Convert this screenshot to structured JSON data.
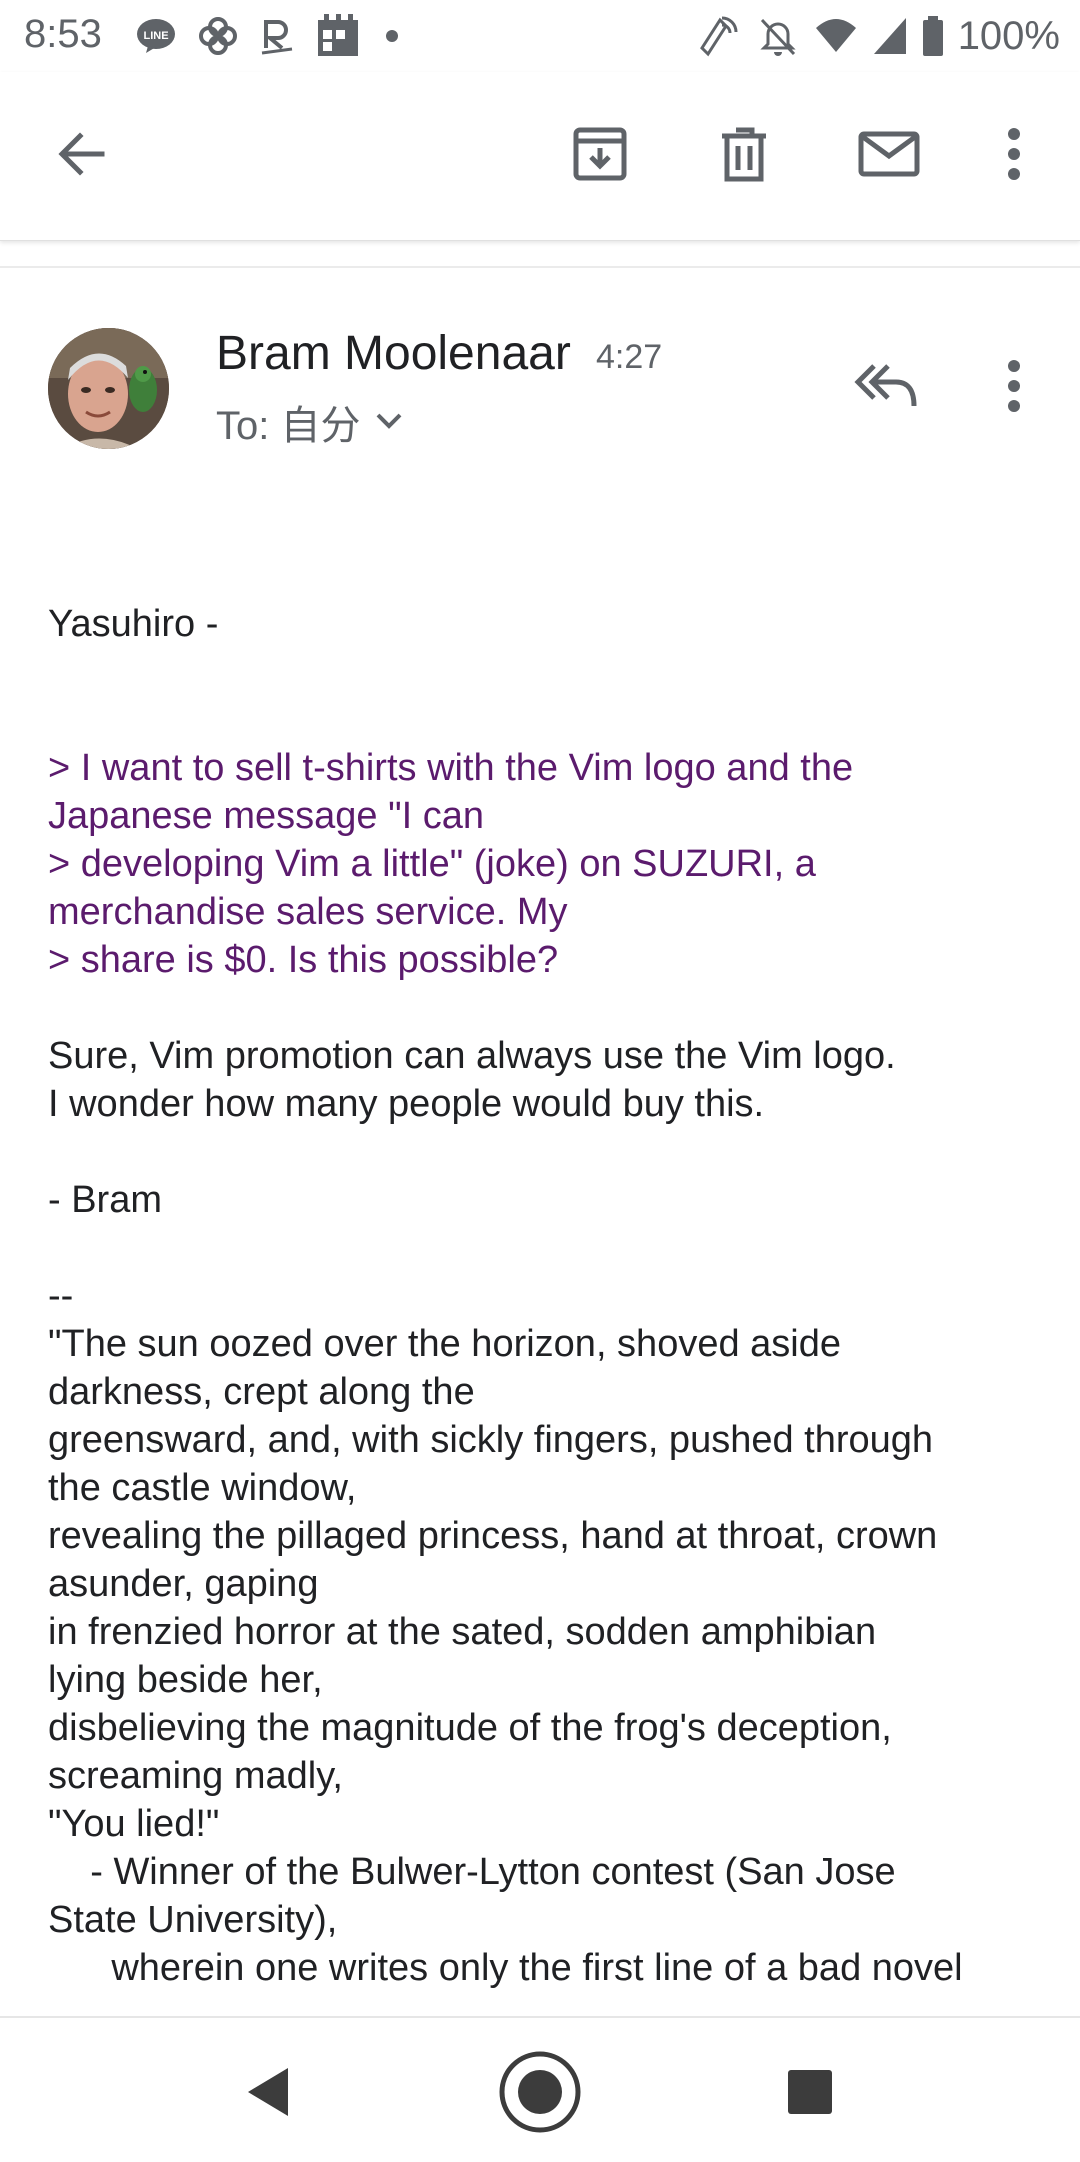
{
  "status_bar": {
    "time": "8:53",
    "battery_text": "100%",
    "left_icons": [
      "line-app-icon",
      "pinwheel-app-icon",
      "rakuten-app-icon",
      "calendar-app-icon",
      "more-notifications-dot-icon"
    ],
    "right_icons": [
      "nfc-icon",
      "silent-mode-icon",
      "wifi-icon",
      "cell-signal-icon",
      "battery-icon"
    ]
  },
  "toolbar": {
    "back_icon": "arrow-back-icon",
    "actions": [
      "archive-icon",
      "delete-icon",
      "mark-unread-icon",
      "overflow-menu-icon"
    ]
  },
  "message": {
    "sender": "Bram Moolenaar",
    "time": "4:27",
    "recipient": "To: 自分",
    "greeting": "Yasuhiro -",
    "quoted_lines": [
      "> I want to sell t-shirts with the Vim logo and the",
      "Japanese message \"I can",
      "> developing Vim a little\" (joke) on SUZURI, a",
      "merchandise sales service. My",
      "> share is $0. Is this possible?"
    ],
    "reply_lines": [
      "Sure, Vim promotion can always use the Vim logo.",
      "I wonder how many people would buy this."
    ],
    "signoff": "- Bram",
    "signature_lines": [
      "--",
      "\"The sun oozed over the horizon, shoved aside",
      "darkness, crept along the",
      "greensward, and, with sickly fingers, pushed through",
      "the castle window,",
      "revealing the pillaged princess, hand at throat, crown",
      "asunder, gaping",
      "in frenzied horror at the sated, sodden amphibian",
      "lying beside her,",
      "disbelieving the magnitude of the frog's deception,",
      "screaming madly,",
      "\"You lied!\"",
      "    - Winner of the Bulwer-Lytton contest (San Jose",
      "State University),",
      "      wherein one writes only the first line of a bad novel"
    ]
  },
  "nav_bar": {
    "icons": [
      "nav-back-icon",
      "nav-home-icon",
      "nav-recents-icon"
    ]
  },
  "colors": {
    "quoted_text": "#5b1b6d",
    "icon_gray": "#5f6368",
    "text": "#202124"
  }
}
